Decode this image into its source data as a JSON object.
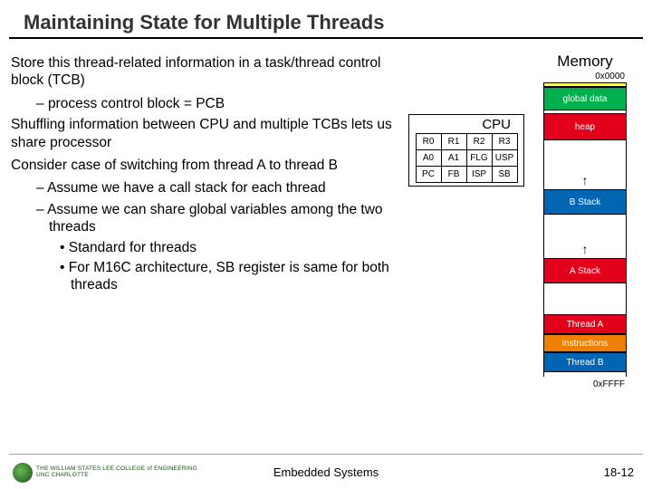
{
  "title": "Maintaining State for Multiple Threads",
  "body": {
    "p1": "Store this thread-related information in a task/thread control block (TCB)",
    "p1s1": "process control block = PCB",
    "p2": "Shuffling information between CPU and multiple TCBs lets us share processor",
    "p3": "Consider case of switching from thread A to thread B",
    "p3s1": "Assume we have a call stack for each thread",
    "p3s2": "Assume we can share global variables among the two threads",
    "p3s2a": "Standard for threads",
    "p3s2b": "For M16C architecture, SB register is same for both threads"
  },
  "cpu": {
    "label": "CPU",
    "rows": [
      [
        "R0",
        "R1",
        "R2",
        "R3"
      ],
      [
        "A0",
        "A1",
        "FLG",
        "USP"
      ],
      [
        "PC",
        "FB",
        "ISP",
        "SB"
      ]
    ]
  },
  "memory": {
    "title": "Memory",
    "addr_top": "0x0000",
    "addr_bot": "0xFFFF",
    "segs": [
      {
        "label": "",
        "bg": "#ffff5a",
        "h": 5
      },
      {
        "label": "global data",
        "bg": "#00b04f",
        "h": 26
      },
      {
        "label": "",
        "bg": "#ffffff",
        "h": 3
      },
      {
        "label": "heap",
        "bg": "#e2001a",
        "h": 30
      },
      {
        "label": "",
        "bg": "#ffffff",
        "h": 34
      },
      {
        "label": "↑",
        "bg": "#ffffff",
        "h": 20,
        "arrow": true
      },
      {
        "label": "B Stack",
        "bg": "#0066b3",
        "h": 28
      },
      {
        "label": "",
        "bg": "#ffffff",
        "h": 28
      },
      {
        "label": "↑",
        "bg": "#ffffff",
        "h": 20,
        "arrow": true
      },
      {
        "label": "A Stack",
        "bg": "#e2001a",
        "h": 28
      },
      {
        "label": "",
        "bg": "#ffffff",
        "h": 34
      },
      {
        "label": "Thread A",
        "bg": "#e2001a",
        "h": 22
      },
      {
        "label": "instructions",
        "bg": "#ee7f00",
        "h": 20
      },
      {
        "label": "Thread B",
        "bg": "#0066b3",
        "h": 22
      },
      {
        "label": "",
        "bg": "#ffffff",
        "h": 5
      }
    ]
  },
  "footer": {
    "center": "Embedded Systems",
    "right": "18-12",
    "logo_line1": "THE WILLIAM STATES LEE COLLEGE of ENGINEERING",
    "logo_line2": "UNC CHARLOTTE"
  }
}
